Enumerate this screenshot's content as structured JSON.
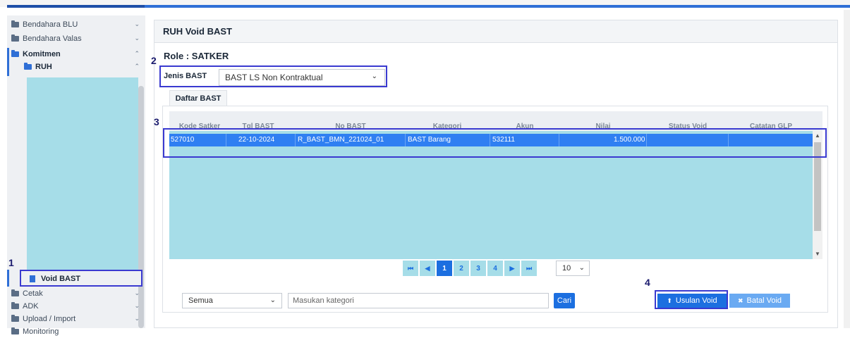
{
  "sidebar": {
    "items": [
      {
        "label": "Bendahara BLU"
      },
      {
        "label": "Bendahara Valas"
      },
      {
        "label": "Komitmen"
      },
      {
        "label": "RUH"
      }
    ],
    "active_item": "Void BAST",
    "bottom_items": [
      {
        "label": "Cetak"
      },
      {
        "label": "ADK"
      },
      {
        "label": "Upload / Import"
      },
      {
        "label": "Monitoring"
      }
    ]
  },
  "page": {
    "title": "RUH Void BAST",
    "role_label": "Role : SATKER",
    "jenis_label": "Jenis BAST",
    "jenis_value": "BAST LS Non Kontraktual",
    "tab_label": "Daftar BAST"
  },
  "table": {
    "columns": [
      "Kode Satker",
      "Tgl BAST",
      "No BAST",
      "Kategori",
      "Akun",
      "Nilai",
      "Status Void",
      "Catatan GLP"
    ],
    "rows": [
      {
        "kode_satker": "527010",
        "tgl_bast": "22-10-2024",
        "no_bast": "R_BAST_BMN_221024_01",
        "kategori": "BAST Barang",
        "akun": "532111",
        "nilai": "1.500.000",
        "status_void": "",
        "catatan_glp": ""
      }
    ]
  },
  "pager": {
    "first": "⏮",
    "prev": "◀",
    "pages": [
      "1",
      "2",
      "3",
      "4"
    ],
    "current": "1",
    "next": "▶",
    "last": "⏭",
    "page_size": "10"
  },
  "filter": {
    "select_value": "Semua",
    "search_placeholder": "Masukan kategori",
    "search_button": "Cari"
  },
  "actions": {
    "usulan_void": "Usulan Void",
    "batal_void": "Batal Void"
  },
  "annotations": [
    "1",
    "2",
    "3",
    "4"
  ],
  "colors": {
    "accent": "#2f6fd6",
    "selected_row": "#2f7ff2",
    "grid_background": "#a6dde8",
    "annotation": "#3a3ad0"
  }
}
